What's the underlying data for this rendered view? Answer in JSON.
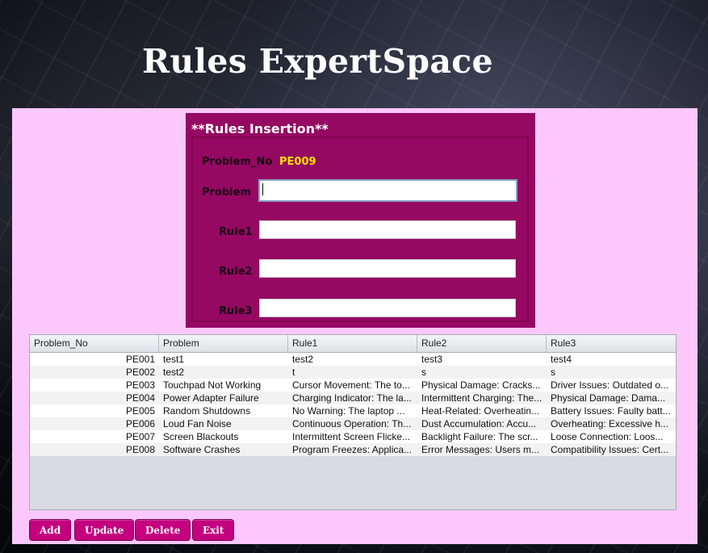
{
  "app": {
    "title": "Rules ExpertSpace"
  },
  "form": {
    "title": "**Rules Insertion**",
    "problem_no_label": "Problem_No",
    "problem_no_value": "PE009",
    "problem_label": "Problem",
    "problem_value": "",
    "rule1_label": "Rule1",
    "rule1_value": "",
    "rule2_label": "Rule2",
    "rule2_value": "",
    "rule3_label": "Rule3",
    "rule3_value": ""
  },
  "table": {
    "headers": [
      "Problem_No",
      "Problem",
      "Rule1",
      "Rule2",
      "Rule3"
    ],
    "rows": [
      [
        "PE001",
        "test1",
        "test2",
        "test3",
        "test4"
      ],
      [
        "PE002",
        "test2",
        "t",
        "s",
        "s"
      ],
      [
        "PE003",
        "Touchpad Not Working",
        "Cursor Movement: The to...",
        "Physical Damage: Cracks...",
        "Driver Issues: Outdated o..."
      ],
      [
        "PE004",
        "Power Adapter Failure",
        "Charging Indicator: The la...",
        "Intermittent Charging: The...",
        "Physical Damage: Dama..."
      ],
      [
        "PE005",
        "Random Shutdowns",
        "No Warning: The laptop ...",
        "Heat-Related: Overheatin...",
        "Battery Issues: Faulty batt..."
      ],
      [
        "PE006",
        "Loud Fan Noise",
        "Continuous Operation: Th...",
        "Dust Accumulation: Accu...",
        "Overheating: Excessive h..."
      ],
      [
        "PE007",
        "Screen Blackouts",
        "Intermittent Screen Flicke...",
        "Backlight Failure: The scr...",
        "Loose Connection: Loos..."
      ],
      [
        "PE008",
        "Software Crashes",
        "Program Freezes: Applica...",
        "Error Messages: Users m...",
        "Compatibility Issues: Cert..."
      ]
    ]
  },
  "buttons": {
    "add": "Add",
    "update": "Update",
    "delete": "Delete",
    "exit": "Exit"
  }
}
